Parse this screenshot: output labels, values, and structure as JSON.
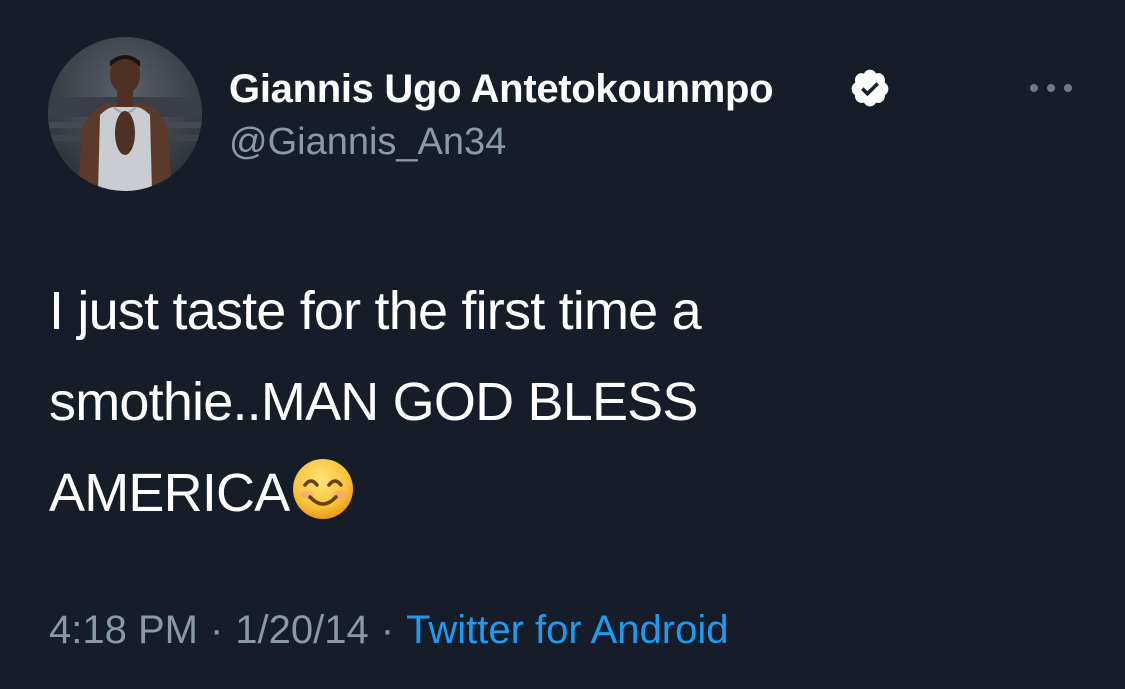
{
  "tweet": {
    "display_name": "Giannis Ugo Antetokounmpo",
    "handle": "@Giannis_An34",
    "text_line1": "I just taste for the first time a",
    "text_line2": "smothie..MAN GOD BLESS",
    "text_line3": "AMERICA",
    "emoji": "smiling-face-with-smiling-eyes",
    "time": "4:18 PM",
    "separator": "·",
    "date": "1/20/14",
    "source": "Twitter for Android"
  },
  "icons": {
    "verified": "verified-badge-icon",
    "more": "more-options-icon"
  },
  "colors": {
    "background": "#161d29",
    "text": "#ffffff",
    "secondary_text": "#8b98a5",
    "link": "#1d9bf0"
  }
}
